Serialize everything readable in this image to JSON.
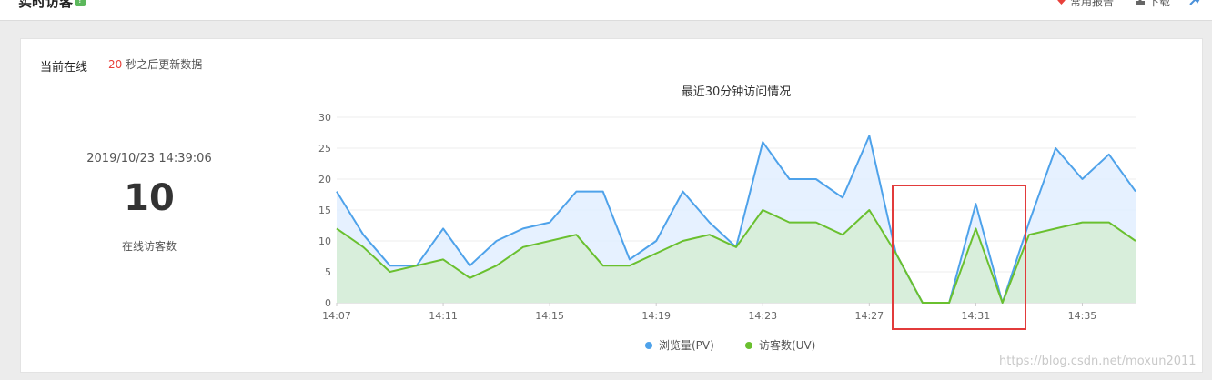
{
  "header": {
    "title": "实时访客",
    "help_badge": "?",
    "actions": [
      {
        "label": "常用报告",
        "icon": "heart-icon"
      },
      {
        "label": "下载",
        "icon": "download-icon"
      },
      {
        "icon": "pin-icon"
      }
    ]
  },
  "panel": {
    "section_label": "当前在线",
    "refresh_seconds": "20",
    "refresh_text": "秒之后更新数据",
    "timestamp": "2019/10/23 14:39:06",
    "online_count": "10",
    "online_label": "在线访客数"
  },
  "colors": {
    "pv": "#4ea2ea",
    "uv": "#6ac02f",
    "pv_fill": "#e2efff",
    "uv_fill": "#d7edd9",
    "highlight": "#e23b3b"
  },
  "chart_data": {
    "type": "area",
    "title": "最近30分钟访问情况",
    "x": [
      "14:07",
      "14:08",
      "14:09",
      "14:10",
      "14:11",
      "14:12",
      "14:13",
      "14:14",
      "14:15",
      "14:16",
      "14:17",
      "14:18",
      "14:19",
      "14:20",
      "14:21",
      "14:22",
      "14:23",
      "14:24",
      "14:25",
      "14:26",
      "14:27",
      "14:28",
      "14:29",
      "14:30",
      "14:31",
      "14:32",
      "14:33",
      "14:34",
      "14:35",
      "14:36",
      "14:37"
    ],
    "x_tick_labels": [
      "14:07",
      "14:11",
      "14:15",
      "14:19",
      "14:23",
      "14:27",
      "14:31",
      "14:35"
    ],
    "series": [
      {
        "name": "浏览量(PV)",
        "values": [
          18,
          11,
          6,
          6,
          12,
          6,
          10,
          12,
          13,
          18,
          18,
          7,
          10,
          18,
          13,
          9,
          26,
          20,
          20,
          17,
          27,
          8,
          0,
          0,
          16,
          0,
          13,
          25,
          20,
          24,
          18
        ]
      },
      {
        "name": "访客数(UV)",
        "values": [
          12,
          9,
          5,
          6,
          7,
          4,
          6,
          9,
          10,
          11,
          6,
          6,
          8,
          10,
          11,
          9,
          15,
          13,
          13,
          11,
          15,
          8,
          0,
          0,
          12,
          0,
          11,
          12,
          13,
          13,
          10
        ]
      }
    ],
    "ylim": [
      0,
      30
    ],
    "y_ticks": [
      0,
      5,
      10,
      15,
      20,
      25,
      30
    ],
    "grid": true,
    "legend": "bottom"
  },
  "watermark": "https://blog.csdn.net/moxun2011"
}
